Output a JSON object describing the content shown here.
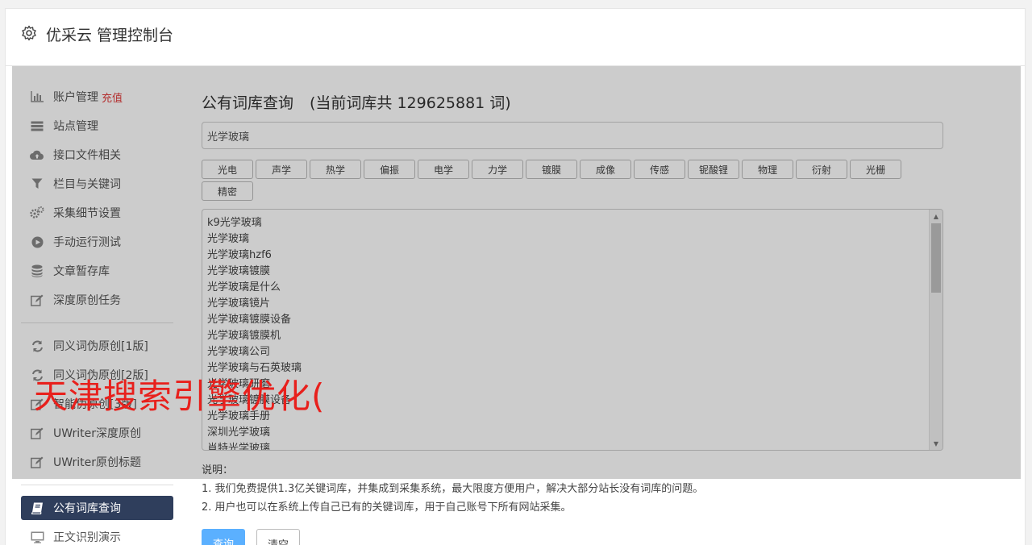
{
  "header": {
    "title": "优采云 管理控制台",
    "icon": "gear-icon"
  },
  "sidebar": {
    "items": [
      {
        "label": "账户管理",
        "extra": "充值",
        "icon": "bar-chart-icon"
      },
      {
        "label": "站点管理",
        "icon": "server-icon"
      },
      {
        "label": "接口文件相关",
        "icon": "cloud-upload-icon"
      },
      {
        "label": "栏目与关键词",
        "icon": "filter-icon"
      },
      {
        "label": "采集细节设置",
        "icon": "gears-icon"
      },
      {
        "label": "手动运行测试",
        "icon": "play-circle-icon"
      },
      {
        "label": "文章暂存库",
        "icon": "database-icon"
      },
      {
        "label": "深度原创任务",
        "icon": "edit-icon"
      },
      {
        "label": "同义词伪原创[1版]",
        "icon": "refresh-icon"
      },
      {
        "label": "同义词伪原创[2版]",
        "icon": "refresh-icon"
      },
      {
        "label": "智能伪原创[3版]",
        "icon": "edit-icon"
      },
      {
        "label": "UWriter深度原创",
        "icon": "edit-icon"
      },
      {
        "label": "UWriter原创标题",
        "icon": "edit-icon"
      },
      {
        "label": "公有词库查询",
        "icon": "book-icon",
        "active": true
      },
      {
        "label": "正文识别演示",
        "icon": "monitor-icon"
      }
    ]
  },
  "main": {
    "title": "公有词库查询",
    "count_text": "(当前词库共 129625881 词)",
    "search_value": "光学玻璃",
    "chips": [
      "光电",
      "声学",
      "热学",
      "偏振",
      "电学",
      "力学",
      "镀膜",
      "成像",
      "传感",
      "铌酸锂",
      "物理",
      "衍射",
      "光栅",
      "精密"
    ],
    "results": [
      "k9光学玻璃",
      "光学玻璃",
      "光学玻璃hzf6",
      "光学玻璃镀膜",
      "光学玻璃是什么",
      "光学玻璃镜片",
      "光学玻璃镀膜设备",
      "光学玻璃镀膜机",
      "光学玻璃公司",
      "光学玻璃与石英玻璃",
      "光学玻璃研磨",
      "光学玻璃镀膜设备",
      "光学玻璃手册",
      "深圳光学玻璃",
      "肖特光学玻璃"
    ],
    "notes": {
      "heading": "说明：",
      "line1": "1. 我们免费提供1.3亿关键词库，并集成到采集系统，最大限度方便用户，解决大部分站长没有词库的问题。",
      "line2": "2. 用户也可以在系统上传自己已有的关键词库，用于自己账号下所有网站采集。"
    },
    "query_button": "查询",
    "clear_button": "清空"
  },
  "watermark": "天津搜索引擎优化(",
  "colors": {
    "accent": "#5bb0ff",
    "active_nav": "#2f3e5c",
    "watermark": "#e8201c",
    "recharge": "#e03b3b"
  }
}
